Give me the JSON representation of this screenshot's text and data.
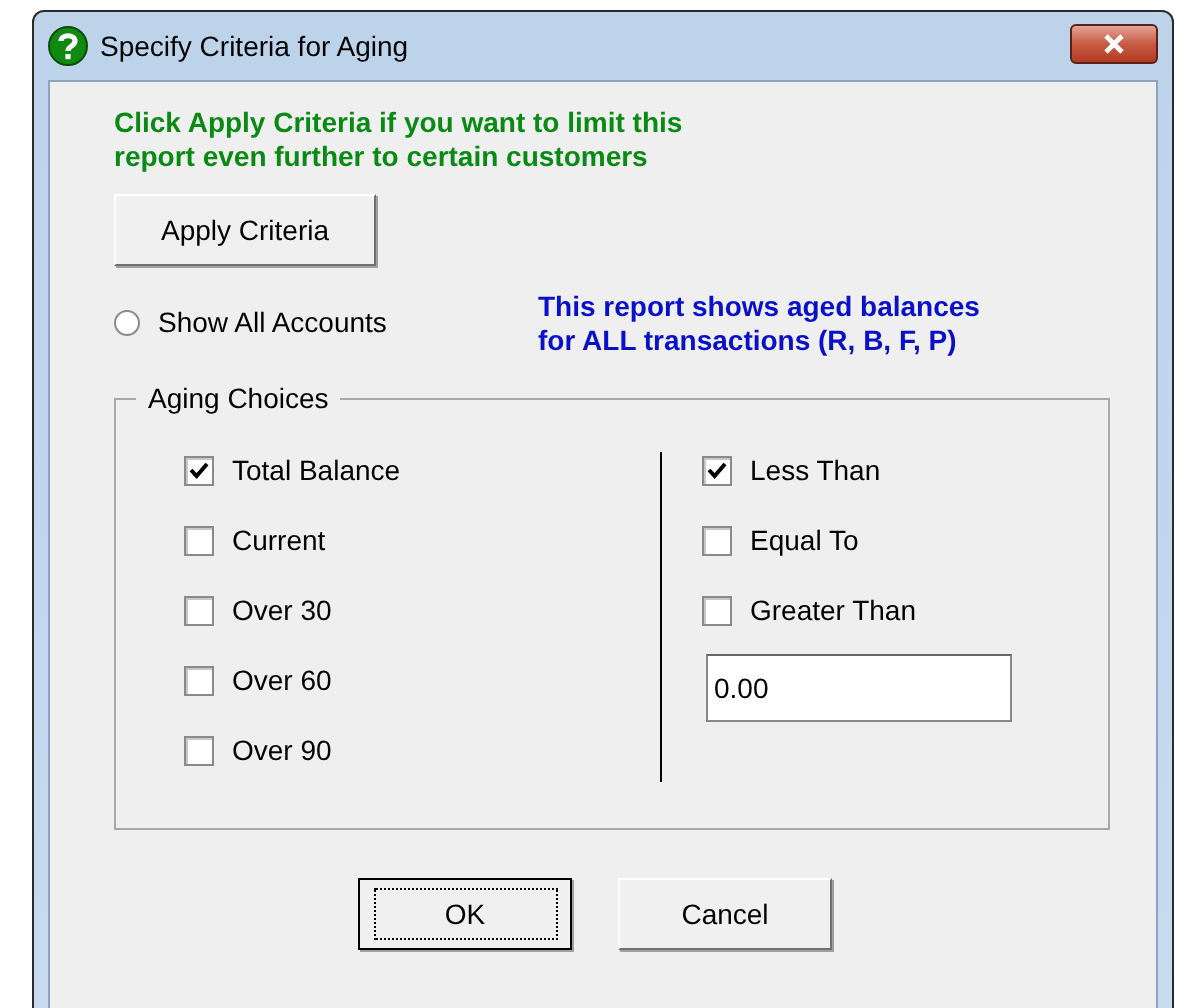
{
  "window": {
    "title": "Specify Criteria for Aging"
  },
  "instruction_lines": [
    "Click Apply Criteria if you want to limit this",
    "report even further to certain customers"
  ],
  "apply_button": "Apply Criteria",
  "show_all": {
    "label": "Show All Accounts",
    "selected": false
  },
  "note_lines": [
    "This report shows aged balances",
    "for ALL transactions (R, B, F, P)"
  ],
  "aging_choices": {
    "title": "Aging Choices",
    "periods": [
      {
        "label": "Total Balance",
        "checked": true
      },
      {
        "label": "Current",
        "checked": false
      },
      {
        "label": "Over 30",
        "checked": false
      },
      {
        "label": "Over 60",
        "checked": false
      },
      {
        "label": "Over 90",
        "checked": false
      }
    ],
    "comparisons": [
      {
        "label": "Less Than",
        "checked": true
      },
      {
        "label": "Equal To",
        "checked": false
      },
      {
        "label": "Greater Than",
        "checked": false
      }
    ],
    "amount": {
      "value": "0.00"
    }
  },
  "buttons": [
    {
      "label": "OK",
      "default": true
    },
    {
      "label": "Cancel",
      "default": false
    }
  ]
}
